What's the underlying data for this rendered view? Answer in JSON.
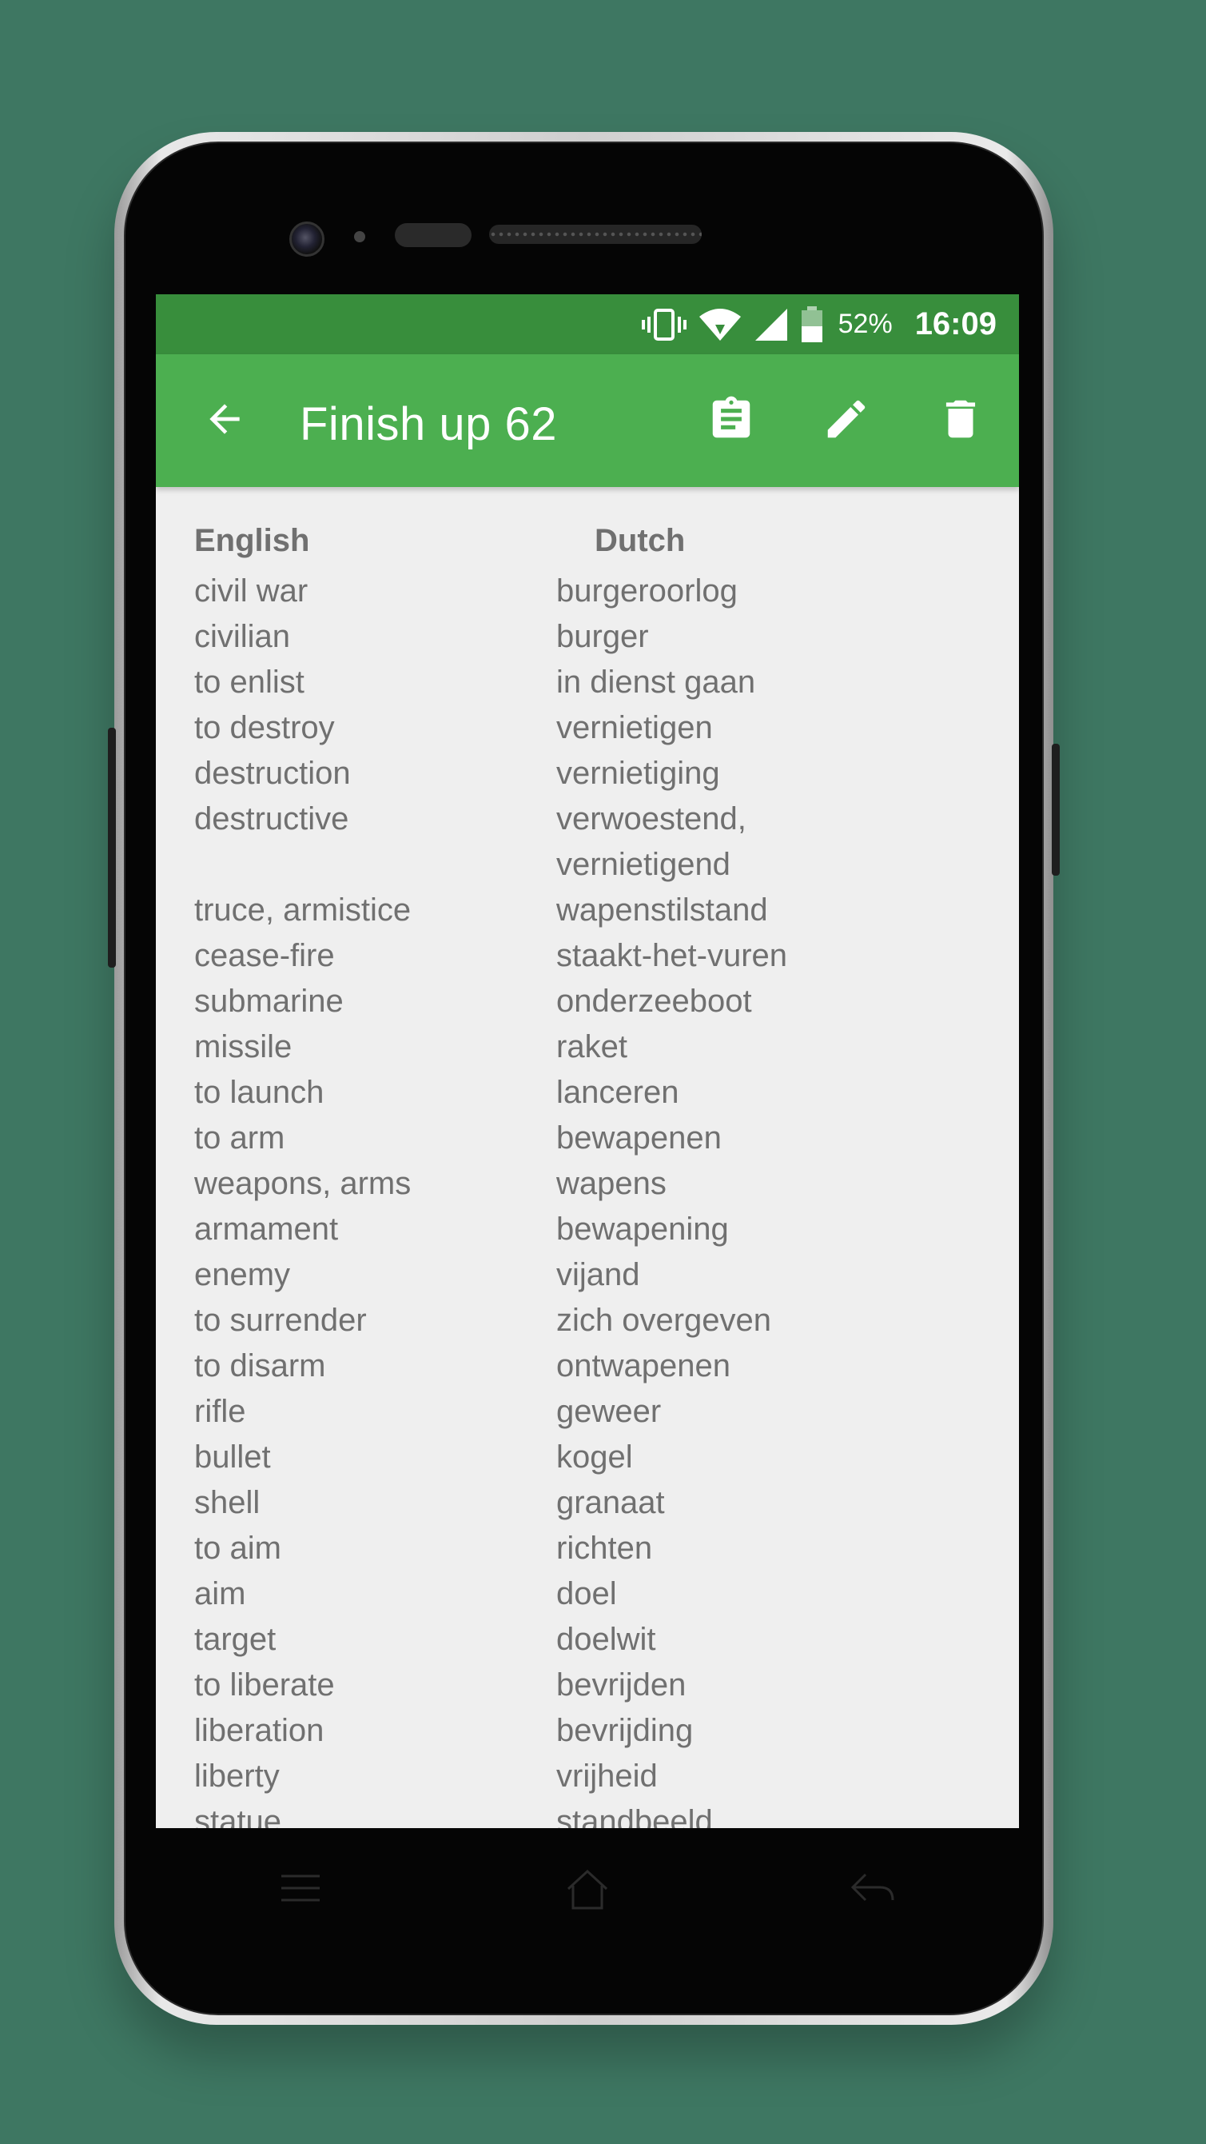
{
  "status_bar": {
    "battery_percent": "52%",
    "time": "16:09",
    "icons": [
      "vibrate-icon",
      "wifi-icon",
      "signal-icon",
      "battery-icon"
    ]
  },
  "app_bar": {
    "title": "Finish up 62",
    "actions": [
      "back-arrow-icon",
      "clipboard-icon",
      "edit-pencil-icon",
      "delete-trash-icon"
    ]
  },
  "table": {
    "headers": {
      "english": "English",
      "dutch": "Dutch"
    },
    "rows": [
      {
        "en": "civil war",
        "nl": "burgeroorlog"
      },
      {
        "en": "civilian",
        "nl": "burger"
      },
      {
        "en": "to enlist",
        "nl": "in dienst gaan"
      },
      {
        "en": "to destroy",
        "nl": "vernietigen"
      },
      {
        "en": "destruction",
        "nl": "vernietiging"
      },
      {
        "en": "destructive",
        "nl": "verwoestend,\nvernietigend"
      },
      {
        "en": "truce, armistice",
        "nl": "wapenstilstand"
      },
      {
        "en": "cease-fire",
        "nl": "staakt-het-vuren"
      },
      {
        "en": "submarine",
        "nl": "onderzeeboot"
      },
      {
        "en": "missile",
        "nl": "raket"
      },
      {
        "en": "to launch",
        "nl": "lanceren"
      },
      {
        "en": "to arm",
        "nl": "bewapenen"
      },
      {
        "en": "weapons, arms",
        "nl": "wapens"
      },
      {
        "en": "armament",
        "nl": "bewapening"
      },
      {
        "en": "enemy",
        "nl": "vijand"
      },
      {
        "en": "to surrender",
        "nl": "zich overgeven"
      },
      {
        "en": "to disarm",
        "nl": "ontwapenen"
      },
      {
        "en": "rifle",
        "nl": "geweer"
      },
      {
        "en": "bullet",
        "nl": "kogel"
      },
      {
        "en": "shell",
        "nl": "granaat"
      },
      {
        "en": "to aim",
        "nl": "richten"
      },
      {
        "en": "aim",
        "nl": "doel"
      },
      {
        "en": "target",
        "nl": "doelwit"
      },
      {
        "en": "to liberate",
        "nl": "bevrijden"
      },
      {
        "en": "liberation",
        "nl": "bevrijding"
      },
      {
        "en": "liberty",
        "nl": "vrijheid"
      },
      {
        "en": "statue",
        "nl": "standbeeld"
      }
    ]
  },
  "navbar": {
    "icons": [
      "menu-icon",
      "home-icon",
      "back-icon"
    ]
  },
  "colors": {
    "status_bar": "#388e3c",
    "app_bar": "#4caf50",
    "background": "#3e7762",
    "text": "#707070"
  }
}
